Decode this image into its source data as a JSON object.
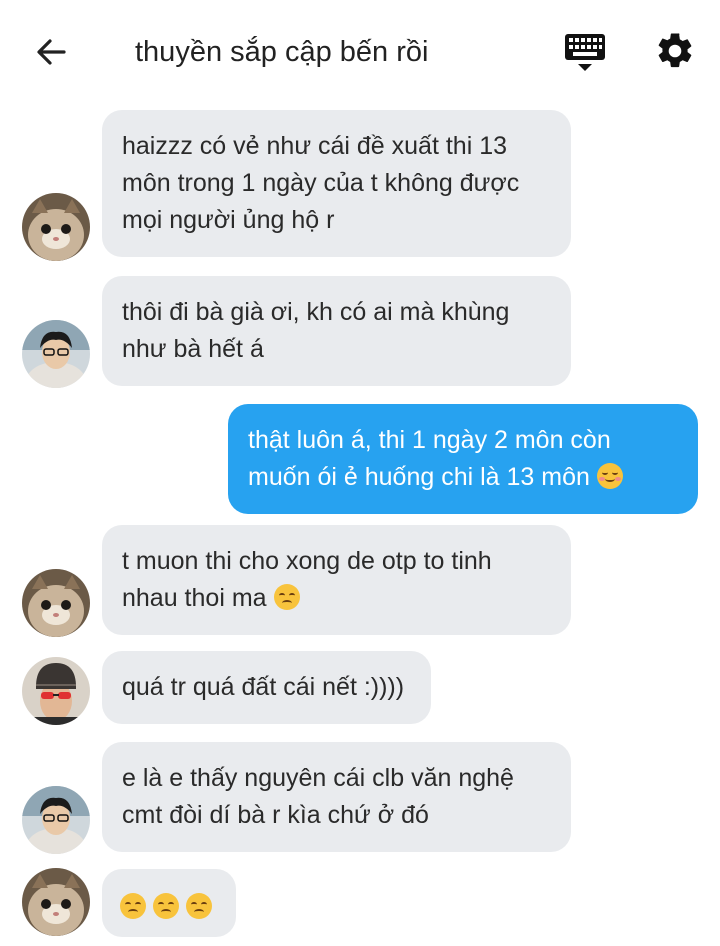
{
  "header": {
    "title": "thuyền sắp cập bến rồi",
    "back_icon": "arrow-left-icon",
    "keyboard_icon": "keyboard-icon",
    "settings_icon": "gear-icon"
  },
  "messages": [
    {
      "direction": "incoming",
      "avatar": "cat-avatar",
      "lines": [
        "haizzz có vẻ như cái đề xuất thi 13",
        "môn trong 1 ngày của t không được",
        "mọi người ủng hộ r"
      ]
    },
    {
      "direction": "incoming",
      "avatar": "glasses-hoodie-avatar",
      "lines": [
        "thôi đi bà già ơi, kh có ai mà khùng",
        "như bà hết á"
      ]
    },
    {
      "direction": "outgoing",
      "lines": [
        "thật luôn á, thi 1 ngày 2 môn còn",
        "muốn ói ẻ huống chi là 13 môn"
      ],
      "emoji": "relieved-smile-emoji"
    },
    {
      "direction": "incoming",
      "avatar": "cat-avatar",
      "lines": [
        "t muon thi cho xong de otp to tinh",
        "nhau thoi ma"
      ],
      "emoji": "disappointed-face-emoji"
    },
    {
      "direction": "incoming",
      "avatar": "sunglasses-beanie-avatar",
      "lines": [
        "quá tr quá đất cái nết :))))"
      ]
    },
    {
      "direction": "incoming",
      "avatar": "glasses-hoodie-avatar",
      "lines": [
        "e là e thấy nguyên cái clb văn nghệ",
        "cmt đòi dí bà r kìa chứ ở đó"
      ]
    },
    {
      "direction": "incoming",
      "avatar": "cat-avatar",
      "lines": [],
      "emoji": "disappointed-face-emoji",
      "emoji_count": 3
    }
  ],
  "colors": {
    "incoming_bubble": "#e9ebee",
    "outgoing_bubble": "#27a2f0",
    "outgoing_text": "#ffffff",
    "incoming_text": "#2a2a2a"
  }
}
